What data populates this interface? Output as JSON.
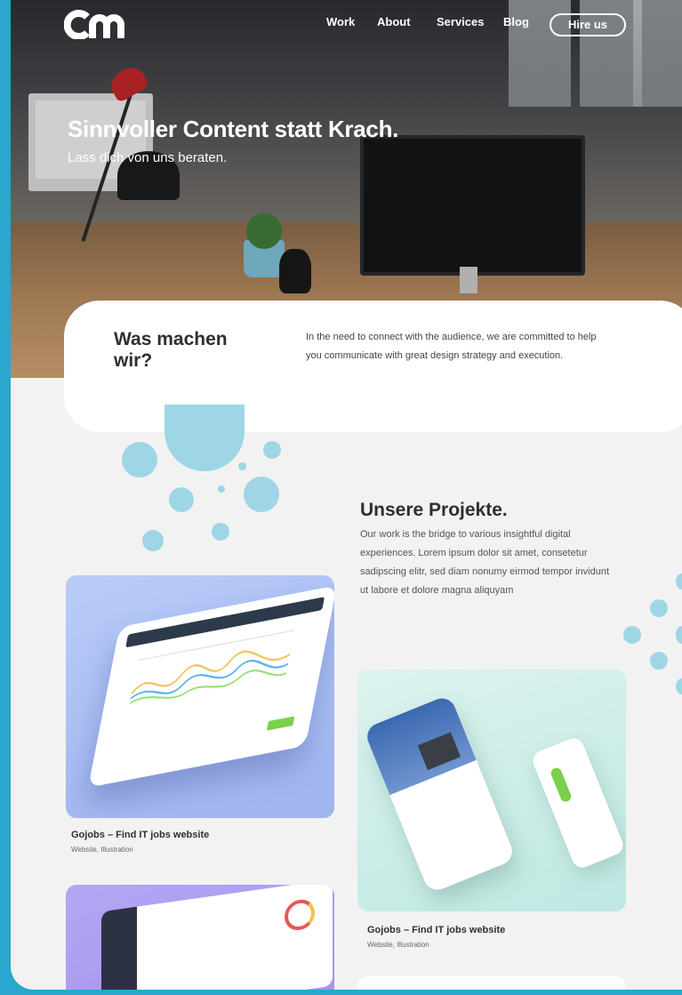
{
  "nav": {
    "logo_text": "cm",
    "items": [
      {
        "label": "Work"
      },
      {
        "label": "About"
      },
      {
        "label": "Services"
      },
      {
        "label": "Blog"
      }
    ],
    "cta_label": "Hire us"
  },
  "hero": {
    "title": "Sinnvoller Content statt Krach.",
    "subtitle": "Lass dich von uns beraten."
  },
  "about": {
    "title": "Was machen wir?",
    "text": "In the need to connect with the audience, we are  committed to help you communicate with great design strategy and execution."
  },
  "projects": {
    "title": "Unsere Projekte.",
    "text": "Our work is the bridge to various insightful digital experiences. Lorem ipsum dolor sit amet, consetetur sadipscing elitr, sed diam nonumy eirmod tempor invidunt ut labore et dolore magna aliquyam",
    "items": [
      {
        "title": "Gojobs – Find IT jobs website",
        "category": "Website, Illustration"
      },
      {
        "title": "Gojobs – Find IT jobs website",
        "category": "Website, Illustration"
      }
    ]
  },
  "colors": {
    "frame": "#2aa6cf",
    "background": "#f2f2f2",
    "bubble": "#9ed6e6",
    "heading": "#2c2f36"
  }
}
